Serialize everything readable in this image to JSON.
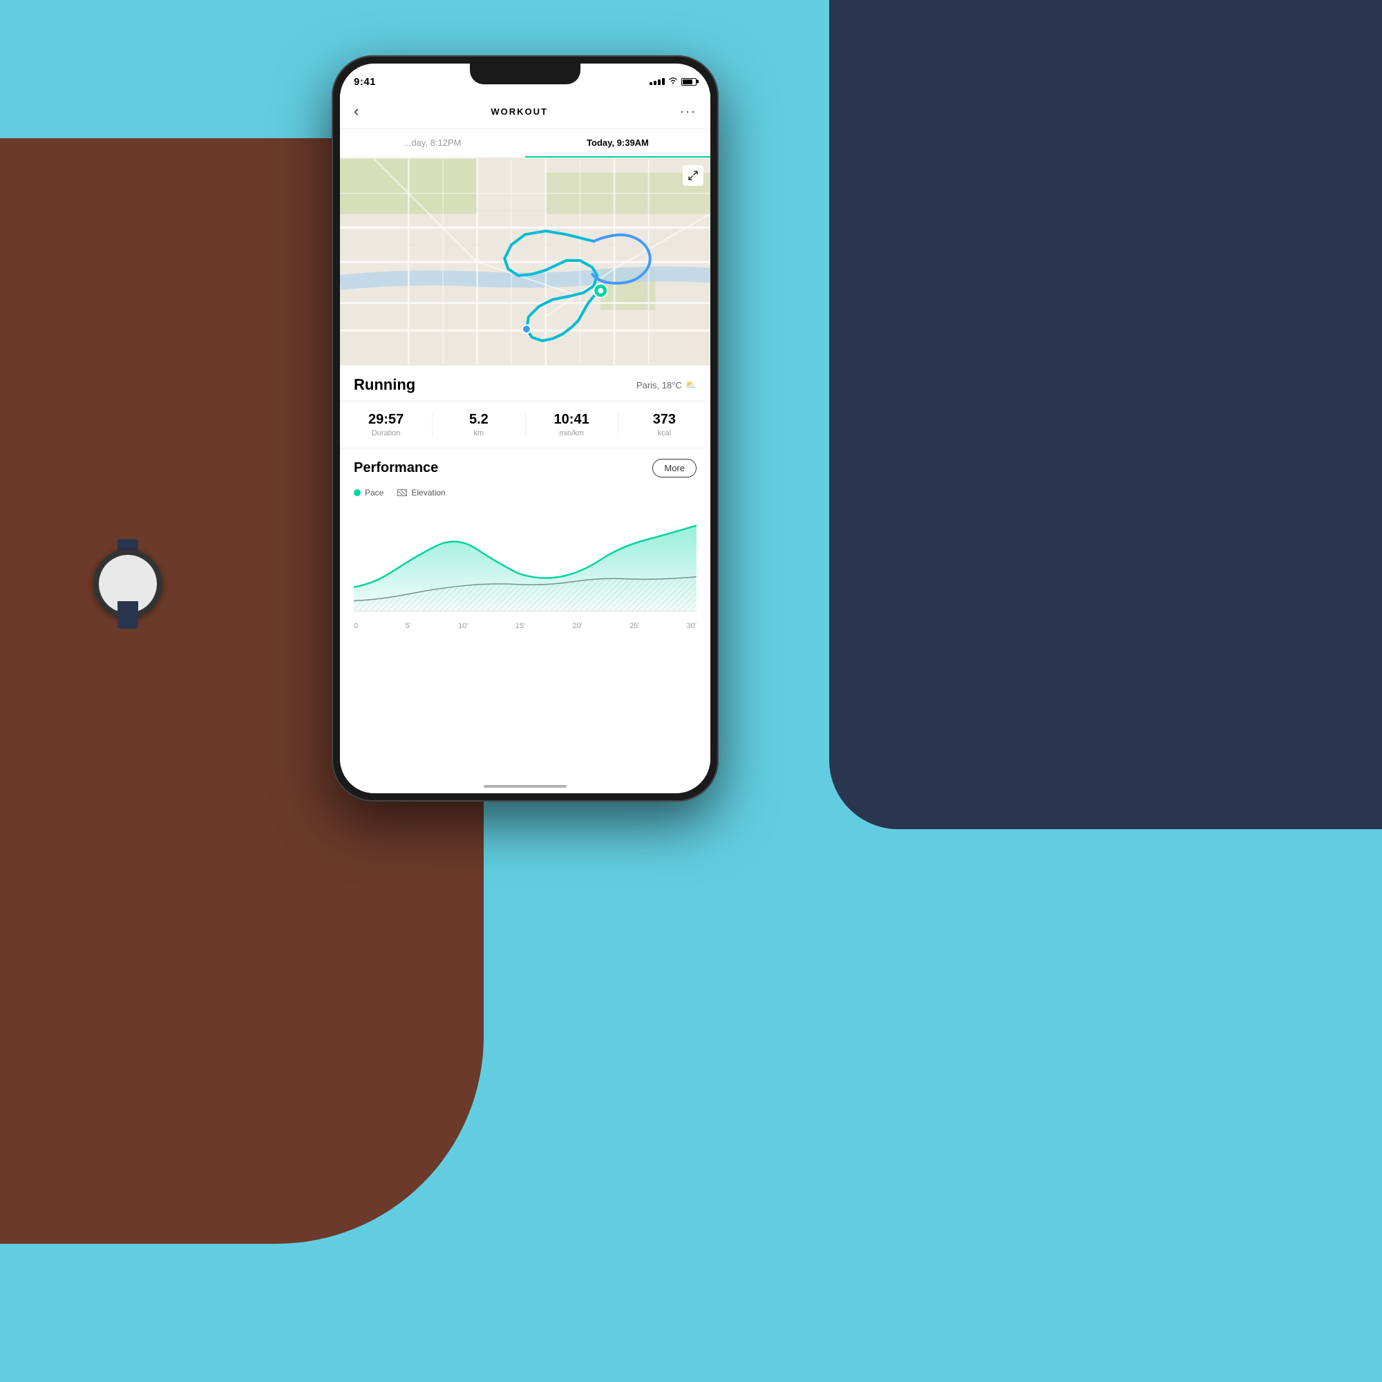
{
  "background": {
    "color": "#5ec8e0"
  },
  "phone": {
    "status_bar": {
      "time": "9:41",
      "signal_bars": 4,
      "wifi": true,
      "battery_pct": 80
    },
    "header": {
      "back_label": "‹",
      "title": "WORKOUT",
      "more_label": "···"
    },
    "date_tabs": [
      {
        "label": "...day, 8:12PM",
        "active": false
      },
      {
        "label": "Today, 9:39AM",
        "active": true
      }
    ],
    "map": {
      "expand_icon": "⤢"
    },
    "activity": {
      "title": "Running",
      "weather": "Paris, 18°C",
      "weather_icon": "☁"
    },
    "stats": [
      {
        "value": "29:57",
        "label": "Duration"
      },
      {
        "value": "5.2",
        "label": "km"
      },
      {
        "value": "10:41",
        "label": "min/km"
      },
      {
        "value": "373",
        "label": "kcal"
      }
    ],
    "performance": {
      "title": "Performance",
      "more_label": "More"
    },
    "chart": {
      "legend": [
        {
          "type": "dot",
          "color": "#00d4a0",
          "label": "Pace"
        },
        {
          "type": "hatch",
          "label": "Elevation"
        }
      ],
      "xaxis": [
        "0",
        "5'",
        "10'",
        "15'",
        "20'",
        "25'",
        "30'"
      ]
    }
  }
}
